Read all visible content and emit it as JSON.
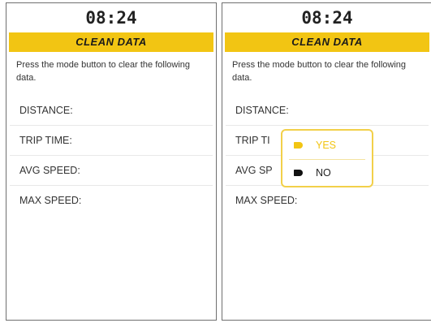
{
  "left_screen": {
    "time": "08:24",
    "title": "CLEAN DATA",
    "message": "Press the mode button to clear the following data.",
    "rows": [
      "DISTANCE:",
      "TRIP TIME:",
      "AVG SPEED:",
      "MAX SPEED:"
    ]
  },
  "right_screen": {
    "time": "08:24",
    "title": "CLEAN DATA",
    "message": "Press the mode button to clear the following data.",
    "rows": [
      "DISTANCE:",
      "TRIP TI",
      "AVG SP",
      "MAX SPEED:"
    ],
    "dialog": {
      "yes_label": "YES",
      "no_label": "NO",
      "selected": "YES"
    }
  },
  "colors": {
    "accent": "#f2c513",
    "frame": "#6f6f6f",
    "text": "#333333"
  }
}
